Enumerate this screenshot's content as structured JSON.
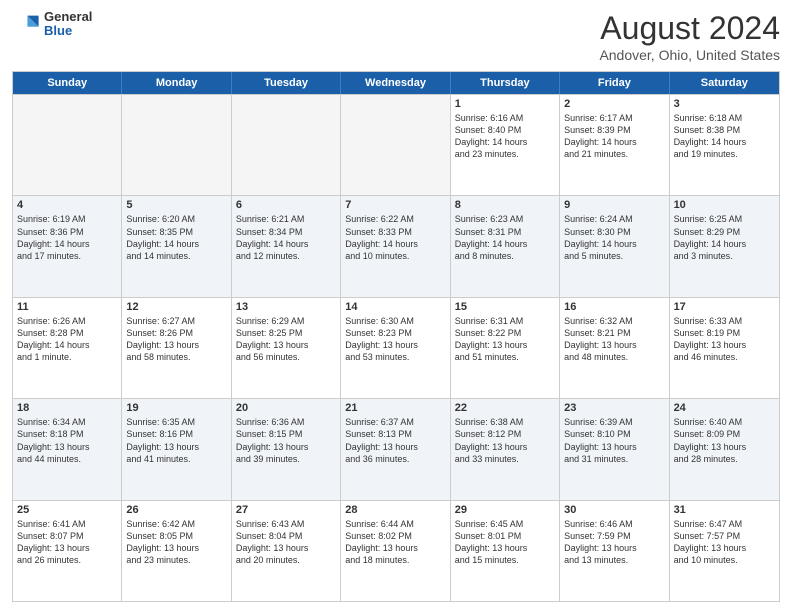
{
  "header": {
    "logo_general": "General",
    "logo_blue": "Blue",
    "main_title": "August 2024",
    "subtitle": "Andover, Ohio, United States"
  },
  "weekdays": [
    "Sunday",
    "Monday",
    "Tuesday",
    "Wednesday",
    "Thursday",
    "Friday",
    "Saturday"
  ],
  "rows": [
    [
      {
        "day": "",
        "info": "",
        "empty": true
      },
      {
        "day": "",
        "info": "",
        "empty": true
      },
      {
        "day": "",
        "info": "",
        "empty": true
      },
      {
        "day": "",
        "info": "",
        "empty": true
      },
      {
        "day": "1",
        "info": "Sunrise: 6:16 AM\nSunset: 8:40 PM\nDaylight: 14 hours\nand 23 minutes."
      },
      {
        "day": "2",
        "info": "Sunrise: 6:17 AM\nSunset: 8:39 PM\nDaylight: 14 hours\nand 21 minutes."
      },
      {
        "day": "3",
        "info": "Sunrise: 6:18 AM\nSunset: 8:38 PM\nDaylight: 14 hours\nand 19 minutes."
      }
    ],
    [
      {
        "day": "4",
        "info": "Sunrise: 6:19 AM\nSunset: 8:36 PM\nDaylight: 14 hours\nand 17 minutes."
      },
      {
        "day": "5",
        "info": "Sunrise: 6:20 AM\nSunset: 8:35 PM\nDaylight: 14 hours\nand 14 minutes."
      },
      {
        "day": "6",
        "info": "Sunrise: 6:21 AM\nSunset: 8:34 PM\nDaylight: 14 hours\nand 12 minutes."
      },
      {
        "day": "7",
        "info": "Sunrise: 6:22 AM\nSunset: 8:33 PM\nDaylight: 14 hours\nand 10 minutes."
      },
      {
        "day": "8",
        "info": "Sunrise: 6:23 AM\nSunset: 8:31 PM\nDaylight: 14 hours\nand 8 minutes."
      },
      {
        "day": "9",
        "info": "Sunrise: 6:24 AM\nSunset: 8:30 PM\nDaylight: 14 hours\nand 5 minutes."
      },
      {
        "day": "10",
        "info": "Sunrise: 6:25 AM\nSunset: 8:29 PM\nDaylight: 14 hours\nand 3 minutes."
      }
    ],
    [
      {
        "day": "11",
        "info": "Sunrise: 6:26 AM\nSunset: 8:28 PM\nDaylight: 14 hours\nand 1 minute."
      },
      {
        "day": "12",
        "info": "Sunrise: 6:27 AM\nSunset: 8:26 PM\nDaylight: 13 hours\nand 58 minutes."
      },
      {
        "day": "13",
        "info": "Sunrise: 6:29 AM\nSunset: 8:25 PM\nDaylight: 13 hours\nand 56 minutes."
      },
      {
        "day": "14",
        "info": "Sunrise: 6:30 AM\nSunset: 8:23 PM\nDaylight: 13 hours\nand 53 minutes."
      },
      {
        "day": "15",
        "info": "Sunrise: 6:31 AM\nSunset: 8:22 PM\nDaylight: 13 hours\nand 51 minutes."
      },
      {
        "day": "16",
        "info": "Sunrise: 6:32 AM\nSunset: 8:21 PM\nDaylight: 13 hours\nand 48 minutes."
      },
      {
        "day": "17",
        "info": "Sunrise: 6:33 AM\nSunset: 8:19 PM\nDaylight: 13 hours\nand 46 minutes."
      }
    ],
    [
      {
        "day": "18",
        "info": "Sunrise: 6:34 AM\nSunset: 8:18 PM\nDaylight: 13 hours\nand 44 minutes."
      },
      {
        "day": "19",
        "info": "Sunrise: 6:35 AM\nSunset: 8:16 PM\nDaylight: 13 hours\nand 41 minutes."
      },
      {
        "day": "20",
        "info": "Sunrise: 6:36 AM\nSunset: 8:15 PM\nDaylight: 13 hours\nand 39 minutes."
      },
      {
        "day": "21",
        "info": "Sunrise: 6:37 AM\nSunset: 8:13 PM\nDaylight: 13 hours\nand 36 minutes."
      },
      {
        "day": "22",
        "info": "Sunrise: 6:38 AM\nSunset: 8:12 PM\nDaylight: 13 hours\nand 33 minutes."
      },
      {
        "day": "23",
        "info": "Sunrise: 6:39 AM\nSunset: 8:10 PM\nDaylight: 13 hours\nand 31 minutes."
      },
      {
        "day": "24",
        "info": "Sunrise: 6:40 AM\nSunset: 8:09 PM\nDaylight: 13 hours\nand 28 minutes."
      }
    ],
    [
      {
        "day": "25",
        "info": "Sunrise: 6:41 AM\nSunset: 8:07 PM\nDaylight: 13 hours\nand 26 minutes."
      },
      {
        "day": "26",
        "info": "Sunrise: 6:42 AM\nSunset: 8:05 PM\nDaylight: 13 hours\nand 23 minutes."
      },
      {
        "day": "27",
        "info": "Sunrise: 6:43 AM\nSunset: 8:04 PM\nDaylight: 13 hours\nand 20 minutes."
      },
      {
        "day": "28",
        "info": "Sunrise: 6:44 AM\nSunset: 8:02 PM\nDaylight: 13 hours\nand 18 minutes."
      },
      {
        "day": "29",
        "info": "Sunrise: 6:45 AM\nSunset: 8:01 PM\nDaylight: 13 hours\nand 15 minutes."
      },
      {
        "day": "30",
        "info": "Sunrise: 6:46 AM\nSunset: 7:59 PM\nDaylight: 13 hours\nand 13 minutes."
      },
      {
        "day": "31",
        "info": "Sunrise: 6:47 AM\nSunset: 7:57 PM\nDaylight: 13 hours\nand 10 minutes."
      }
    ]
  ]
}
